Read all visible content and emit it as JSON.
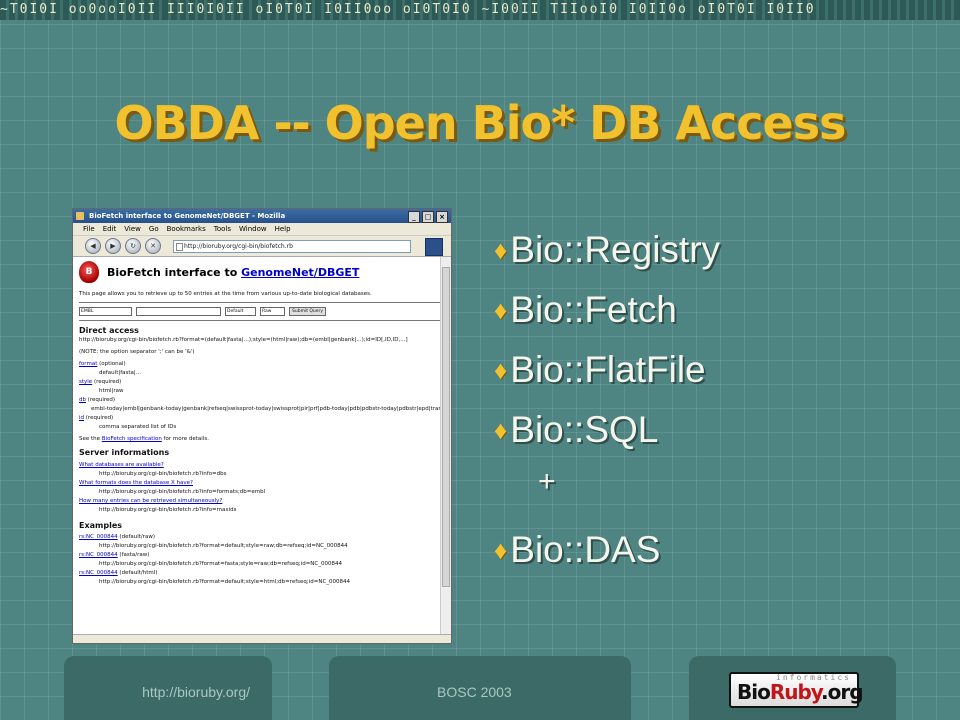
{
  "top_strip": "  ~T0I0I  oo0ooI0II  III0I0II  oI0T0I  I0II0oo  oI0T0I0  ~I00II  TIIooI0  I0II0o  oI0T0I  I0II0",
  "slide": {
    "title": "OBDA  --  Open Bio* DB Access",
    "bullets": [
      "Bio::Registry",
      "Bio::Fetch",
      "Bio::FlatFile",
      "Bio::SQL"
    ],
    "plus": "+",
    "last_bullet": "Bio::DAS",
    "bullet_glyph": "♦",
    "colors": {
      "title": "#f2c12e",
      "bullet_text": "#f5f5ec",
      "background": "#4e8583"
    }
  },
  "browser": {
    "window_title": "BioFetch interface to GenomeNet/DBGET - Mozilla",
    "menu": [
      "File",
      "Edit",
      "View",
      "Go",
      "Bookmarks",
      "Tools",
      "Window",
      "Help"
    ],
    "url": "http://bioruby.org/cgi-bin/biofetch.rb",
    "page": {
      "logo_letter": "B",
      "heading_prefix": "BioFetch interface to ",
      "heading_link": "GenomeNet/DBGET",
      "intro": "This page allows you to retrieve up to 50 entries at the time from various up-to-date biological databases.",
      "form": {
        "db": "EMBL",
        "format": "Default",
        "style": "Raw",
        "submit": "Submit Query"
      },
      "direct_access": {
        "heading": "Direct access",
        "url_pattern": "http://bioruby.org/cgi-bin/biofetch.rb?format=(default|fasta|...);style=(html|raw);db=(embl|genbank|...);id=ID[,ID,ID,...]",
        "note": "(NOTE: the option separator ';' can be '&')",
        "format_label": "format",
        "format_req": " (optional)",
        "format_values": "default|fasta|...",
        "style_label": "style",
        "style_req": " (required)",
        "style_values": "html|raw",
        "db_label": "db",
        "db_req": " (required)",
        "db_values": "embl-today|embl|genbank-today|genbank|refseq|swissprot-today|swissprot|pir|prf|pdb-today|pdb|pdbstr-today|pdbstr|epd|trans",
        "id_label": "id",
        "id_req": " (required)",
        "id_values": "comma separated list of IDs",
        "see_prefix": "See the ",
        "see_link": "BioFetch specification",
        "see_suffix": " for more details."
      },
      "server_info": {
        "heading": "Server informations",
        "q1": "What databases are available?",
        "a1": "http://bioruby.org/cgi-bin/biofetch.rb?info=dbs",
        "q2": "What formats does the database X have?",
        "a2": "http://bioruby.org/cgi-bin/biofetch.rb?info=formats;db=embl",
        "q3": "How many entries can be retrieved simultaneously?",
        "a3": "http://bioruby.org/cgi-bin/biofetch.rb?info=maxids"
      },
      "examples": {
        "heading": "Examples",
        "e1_link": "rs:NC_000844",
        "e1_note": " (default/raw)",
        "e1_url": "http://bioruby.org/cgi-bin/biofetch.rb?format=default;style=raw;db=refseq;id=NC_000844",
        "e2_link": "rs:NC_000844",
        "e2_note": " (fasta/raw)",
        "e2_url": "http://bioruby.org/cgi-bin/biofetch.rb?format=fasta;style=raw;db=refseq;id=NC_000844",
        "e3_link": "rs:NC_000844",
        "e3_note": " (default/html)",
        "e3_url": "http://bioruby.org/cgi-bin/biofetch.rb?format=default;style=html;db=refseq;id=NC_000844"
      }
    }
  },
  "footer": {
    "url": "http://bioruby.org/",
    "event": "BOSC 2003",
    "logo_tag": "informatics",
    "logo_word_black": "Bio",
    "logo_word_red": "Ruby",
    "logo_word_suffix": ".org"
  }
}
